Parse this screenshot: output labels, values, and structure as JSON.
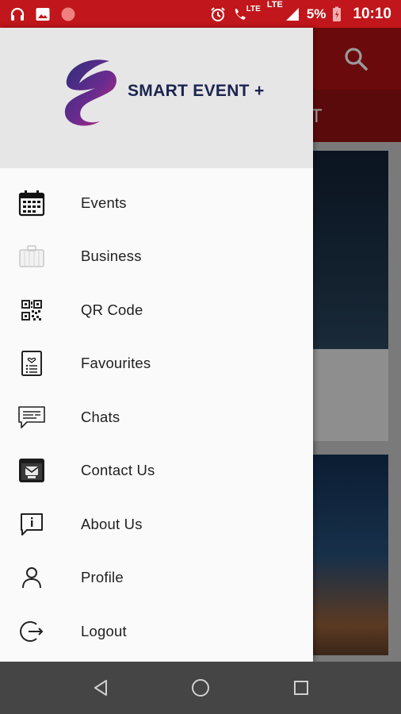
{
  "status_bar": {
    "network_1": "LTE",
    "network_2": "LTE",
    "battery": "5%",
    "time": "10:10",
    "icons": [
      "headset-icon",
      "image-icon",
      "record-icon",
      "alarm-icon",
      "volte-call-icon",
      "signal-icon",
      "battery-icon"
    ],
    "background_color": "#c1161b"
  },
  "drawer": {
    "header": {
      "logo_text": "SMART EVENT +",
      "logo_colors": [
        "#2b2f7a",
        "#8b2a8f",
        "#d0297a"
      ]
    },
    "items": [
      {
        "label": "Events",
        "icon": "calendar-icon"
      },
      {
        "label": "Business",
        "icon": "briefcase-icon"
      },
      {
        "label": "QR Code",
        "icon": "qr-code-icon"
      },
      {
        "label": "Favourites",
        "icon": "favourites-list-icon"
      },
      {
        "label": "Chats",
        "icon": "chat-bubble-icon"
      },
      {
        "label": "Contact Us",
        "icon": "contact-window-icon"
      },
      {
        "label": "About Us",
        "icon": "info-message-icon"
      },
      {
        "label": "Profile",
        "icon": "user-icon"
      },
      {
        "label": "Logout",
        "icon": "logout-icon"
      }
    ]
  },
  "background_app": {
    "tab_partial_text": "T",
    "search_icon": "search-icon"
  },
  "nav_bar": {
    "buttons": [
      "back-icon",
      "home-icon",
      "recents-icon"
    ]
  }
}
